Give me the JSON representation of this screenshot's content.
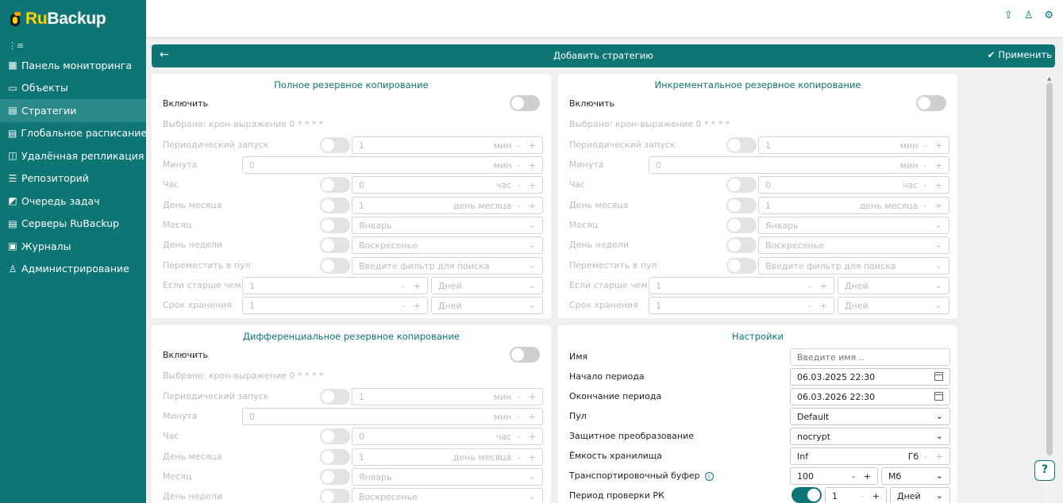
{
  "app": {
    "logo_ru": "Ru",
    "logo_backup": "Backup"
  },
  "sidebar": {
    "collapse_icon": "⋮≡",
    "items": [
      {
        "icon": "dashboard-icon",
        "glyph": "▦",
        "label": "Панель мониторинга"
      },
      {
        "icon": "monitor-icon",
        "glyph": "▭",
        "label": "Объекты"
      },
      {
        "icon": "document-icon",
        "glyph": "▤",
        "label": "Стратегии",
        "active": true
      },
      {
        "icon": "calendar-list-icon",
        "glyph": "▤",
        "label": "Глобальное расписание"
      },
      {
        "icon": "replication-icon",
        "glyph": "◫",
        "label": "Удалённая репликация"
      },
      {
        "icon": "database-icon",
        "glyph": "☰",
        "label": "Репозиторий"
      },
      {
        "icon": "queue-icon",
        "glyph": "◩",
        "label": "Очередь задач"
      },
      {
        "icon": "server-icon",
        "glyph": "▤",
        "label": "Серверы RuBackup"
      },
      {
        "icon": "journal-icon",
        "glyph": "▣",
        "label": "Журналы"
      },
      {
        "icon": "admin-icon",
        "glyph": "♙",
        "label": "Администрирование"
      }
    ]
  },
  "header": {
    "title": "Добавить стратегию",
    "apply_label": "Применить"
  },
  "full": {
    "title": "Полное резервное копирование",
    "enable": "Включить",
    "selected": "Выбрано: крон-выражение 0 * * * *",
    "periodic": "Периодический запуск",
    "periodic_value": "1",
    "periodic_unit": "мин",
    "minute": "Минута",
    "minute_value": "0",
    "minute_unit": "мин",
    "hour": "Час",
    "hour_value": "0",
    "hour_unit": "час",
    "day": "День месяца",
    "day_value": "1",
    "day_unit": "день месяца",
    "month": "Месяц",
    "month_value": "Январь",
    "weekday": "День недели",
    "weekday_value": "Воскресенье",
    "move": "Переместить в пул",
    "move_placeholder": "Введите фильтр для поиска",
    "older": "Если старше чем",
    "older_value": "1",
    "older_unit": "Дней",
    "retention": "Срок хранения",
    "retention_value": "1",
    "retention_unit": "Дней"
  },
  "incr": {
    "title": "Инкрементальное резервное копирование",
    "enable": "Включить",
    "selected": "Выбрано: крон-выражение 0 * * * *",
    "periodic": "Периодический запуск",
    "periodic_value": "1",
    "periodic_unit": "мин",
    "minute": "Минута",
    "minute_value": "0",
    "minute_unit": "мин",
    "hour": "Час",
    "hour_value": "0",
    "hour_unit": "час",
    "day": "День месяца",
    "day_value": "1",
    "day_unit": "день месяца",
    "month": "Месяц",
    "month_value": "Январь",
    "weekday": "День недели",
    "weekday_value": "Воскресенье",
    "move": "Переместить в пул",
    "move_placeholder": "Введите фильтр для поиска",
    "older": "Если старше чем",
    "older_value": "1",
    "older_unit": "Дней",
    "retention": "Срок хранения",
    "retention_value": "1",
    "retention_unit": "Дней"
  },
  "diff": {
    "title": "Дифференциальное резервное копирование",
    "enable": "Включить",
    "selected": "Выбрано: крон-выражение 0 * * * *",
    "periodic": "Периодический запуск",
    "periodic_value": "1",
    "periodic_unit": "мин",
    "minute": "Минута",
    "minute_value": "0",
    "minute_unit": "мин",
    "hour": "Час",
    "hour_value": "0",
    "hour_unit": "час",
    "day": "День месяца",
    "day_value": "1",
    "day_unit": "день месяца",
    "month": "Месяц",
    "month_value": "Январь",
    "weekday": "День недели",
    "weekday_value": "Воскресенье"
  },
  "settings": {
    "title": "Настройки",
    "name": "Имя",
    "name_placeholder": "Введите имя ..",
    "start": "Начало периода",
    "start_value": "06.03.2025 22:30",
    "end": "Окончание периода",
    "end_value": "06.03.2026 22:30",
    "pool": "Пул",
    "pool_value": "Default",
    "protect": "Защитное преобразование",
    "protect_value": "nocrypt",
    "capacity": "Ёмкость хранилища",
    "capacity_value": "Inf",
    "capacity_unit": "Гб",
    "buffer": "Транспортировочный буфер",
    "buffer_value": "100",
    "buffer_unit": "Мб",
    "check": "Период проверки РК",
    "check_value": "1",
    "check_unit": "Дней"
  },
  "stepper": {
    "minus": "-",
    "plus": "+"
  },
  "help_label": "?"
}
